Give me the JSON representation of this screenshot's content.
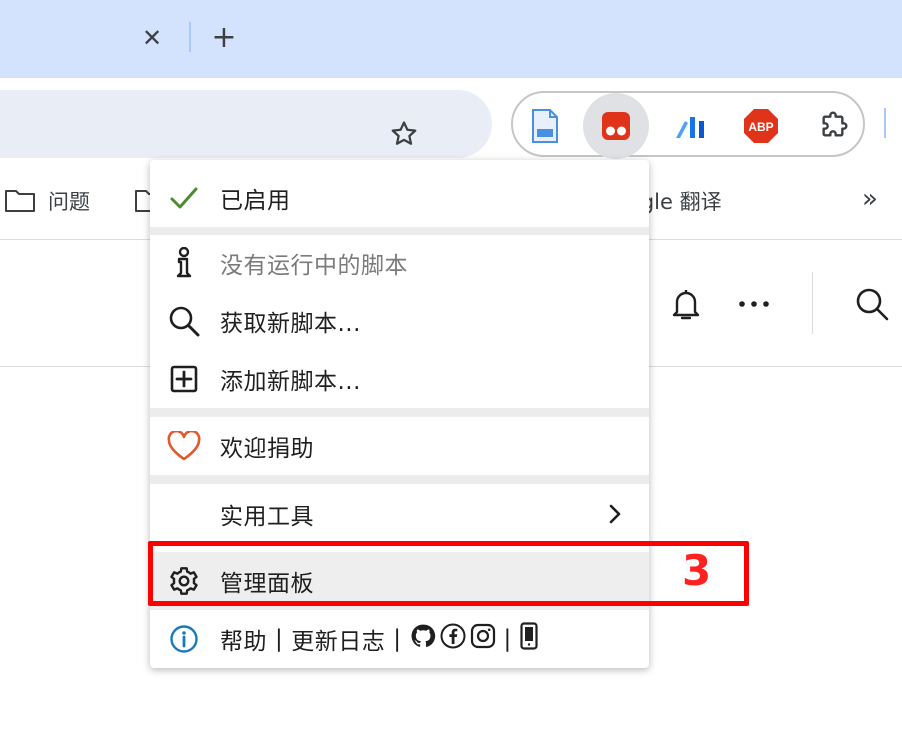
{
  "tabstrip": {
    "close_glyph": "✕",
    "newtab_glyph": "+"
  },
  "toolbar": {
    "extensions": [
      {
        "icon": "document-extension-icon",
        "color": "#4a90e2"
      },
      {
        "icon": "tampermonkey-icon",
        "color": "#e0341a",
        "active": true
      },
      {
        "icon": "analytics-extension-icon",
        "color": "#1a73e8"
      },
      {
        "icon": "adblock-plus-icon",
        "color": "#e0341a",
        "label": "ABP"
      },
      {
        "icon": "puzzle-extensions-icon",
        "color": "#3c4043"
      }
    ]
  },
  "bookmarks": {
    "items": [
      {
        "label": "问题"
      },
      {
        "label": ""
      },
      {
        "label": "ogle 翻译"
      }
    ],
    "more_glyph": "»"
  },
  "menu": {
    "enabled_label": "已启用",
    "no_scripts_label": "没有运行中的脚本",
    "get_scripts_label": "获取新脚本...",
    "add_script_label": "添加新脚本...",
    "donate_label": "欢迎捐助",
    "utilities_label": "实用工具",
    "dashboard_label": "管理面板",
    "help_label": "帮助",
    "changelog_label": "更新日志",
    "separator": "|"
  },
  "colors": {
    "check": "#4c8c2f",
    "heart": "#e05a2b",
    "info": "#1a7ab8",
    "annotation": "#ff0000"
  },
  "annotation": {
    "number": "3"
  }
}
